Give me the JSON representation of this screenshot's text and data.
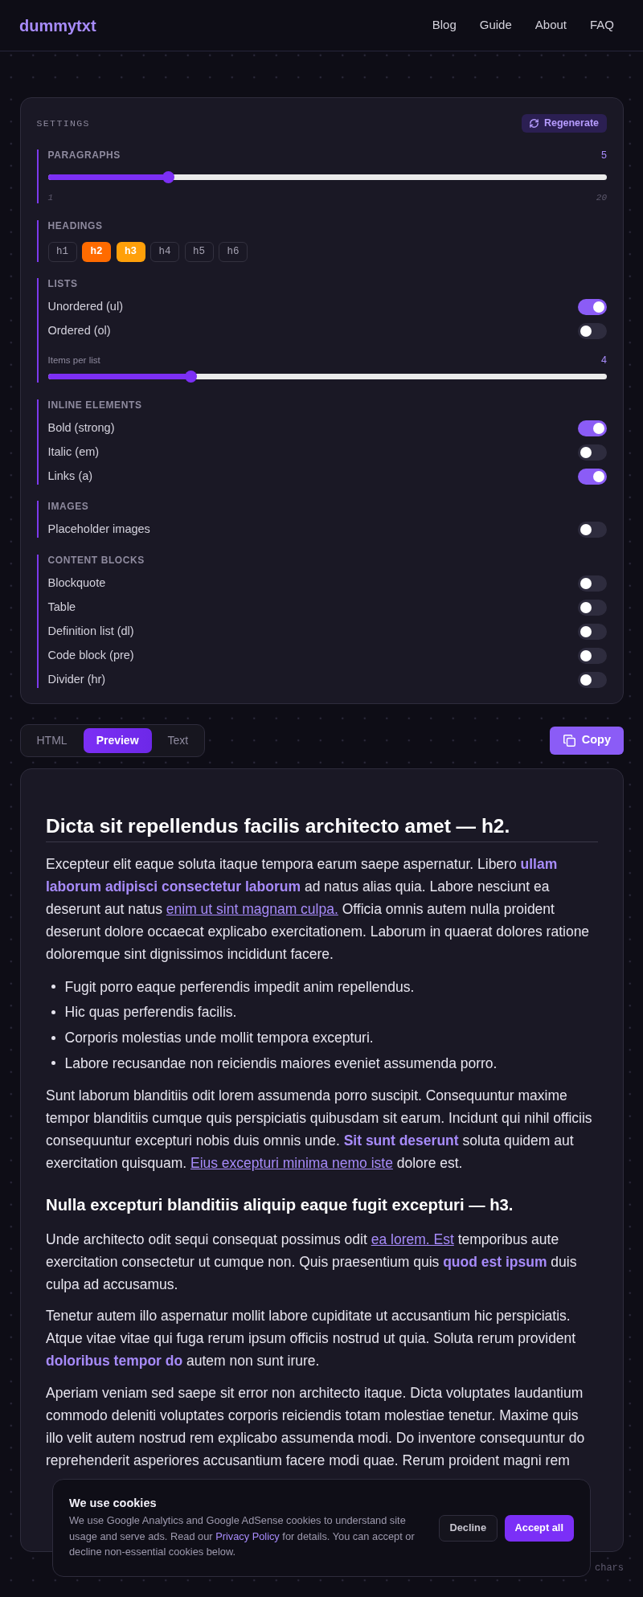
{
  "navbar": {
    "logo": "dummytxt",
    "links": [
      "Blog",
      "Guide",
      "About",
      "FAQ"
    ]
  },
  "settings": {
    "title": "SETTINGS",
    "regenerate_button": "Regenerate",
    "groups": [
      {
        "label": "PARAGRAPHS",
        "items": [
          {
            "kind": "slider",
            "value": "5",
            "level": 0.21,
            "min": "1",
            "max": "20"
          }
        ]
      },
      {
        "label": "HEADINGS",
        "items": [
          {
            "kind": "chips",
            "chips": [
              {
                "label": "h1",
                "selected": false
              },
              {
                "label": "h2",
                "selected": true,
                "color": "#ff6b00"
              },
              {
                "label": "h3",
                "selected": true,
                "color": "#ffa00a"
              },
              {
                "label": "h4",
                "selected": false
              },
              {
                "label": "h5",
                "selected": false
              },
              {
                "label": "h6",
                "selected": false
              }
            ]
          }
        ]
      },
      {
        "label": "LISTS",
        "items": [
          {
            "kind": "toggle",
            "label": "Unordered (ul)",
            "on": true
          },
          {
            "kind": "toggle",
            "label": "Ordered (ol)",
            "on": false
          },
          {
            "kind": "slider",
            "label": "Items per list",
            "value": "4",
            "level": 0.25
          }
        ]
      },
      {
        "label": "INLINE ELEMENTS",
        "items": [
          {
            "kind": "toggle",
            "label": "Bold (strong)",
            "on": true
          },
          {
            "kind": "toggle",
            "label": "Italic (em)",
            "on": false
          },
          {
            "kind": "toggle",
            "label": "Links (a)",
            "on": true
          }
        ]
      },
      {
        "label": "IMAGES",
        "items": [
          {
            "kind": "toggle",
            "label": "Placeholder images",
            "on": false
          }
        ]
      },
      {
        "label": "CONTENT BLOCKS",
        "items": [
          {
            "kind": "toggle",
            "label": "Blockquote",
            "on": false
          },
          {
            "kind": "toggle",
            "label": "Table",
            "on": false
          },
          {
            "kind": "toggle",
            "label": "Definition list (dl)",
            "on": false
          },
          {
            "kind": "toggle",
            "label": "Code block (pre)",
            "on": false
          },
          {
            "kind": "toggle",
            "label": "Divider (hr)",
            "on": false
          }
        ]
      }
    ]
  },
  "output_tabs": [
    {
      "label": "HTML",
      "selected": false
    },
    {
      "label": "Preview",
      "selected": true
    },
    {
      "label": "Text",
      "selected": false
    }
  ],
  "copy_button": "Copy",
  "preview": {
    "blocks": [
      {
        "kind": "h2",
        "text": "Dicta sit repellendus facilis architecto amet — h2."
      },
      {
        "kind": "paragraph",
        "segments": [
          {
            "kind": "text",
            "text": "Excepteur elit eaque soluta itaque tempora earum saepe aspernatur. Libero "
          },
          {
            "kind": "bold",
            "text": "ullam laborum adipisci consectetur laborum"
          },
          {
            "kind": "text",
            "text": " ad natus alias quia. Labore nesciunt ea deserunt aut natus "
          },
          {
            "kind": "link",
            "text": "enim ut sint magnam culpa."
          },
          {
            "kind": "text",
            "text": " Officia omnis autem nulla proident deserunt dolore occaecat explicabo exercitationem. Laborum in quaerat dolores ratione doloremque sint dignissimos incididunt facere."
          }
        ]
      },
      {
        "kind": "bullet_list",
        "items": [
          "Fugit porro eaque perferendis impedit anim repellendus.",
          "Hic quas perferendis facilis.",
          "Corporis molestias unde mollit tempora excepturi.",
          "Labore recusandae non reiciendis maiores eveniet assumenda porro."
        ]
      },
      {
        "kind": "paragraph",
        "segments": [
          {
            "kind": "text",
            "text": "Sunt laborum blanditiis odit lorem assumenda porro suscipit. Consequuntur maxime tempor blanditiis cumque quis perspiciatis quibusdam sit earum. Incidunt qui nihil officiis consequuntur excepturi nobis duis omnis unde. "
          },
          {
            "kind": "bold",
            "text": "Sit sunt deserunt"
          },
          {
            "kind": "text",
            "text": " soluta quidem aut exercitation quisquam. "
          },
          {
            "kind": "link",
            "text": "Eius excepturi minima nemo iste"
          },
          {
            "kind": "text",
            "text": " dolore est."
          }
        ]
      },
      {
        "kind": "h3",
        "text": "Nulla excepturi blanditiis aliquip eaque fugit excepturi — h3."
      },
      {
        "kind": "paragraph",
        "segments": [
          {
            "kind": "text",
            "text": "Unde architecto odit sequi consequat possimus odit "
          },
          {
            "kind": "link",
            "text": "ea lorem. Est"
          },
          {
            "kind": "text",
            "text": " temporibus aute exercitation consectetur ut cumque non. Quis praesentium quis "
          },
          {
            "kind": "bold",
            "text": "quod est ipsum"
          },
          {
            "kind": "text",
            "text": " duis culpa ad accusamus."
          }
        ]
      },
      {
        "kind": "paragraph",
        "segments": [
          {
            "kind": "text",
            "text": "Tenetur autem illo aspernatur mollit labore cupiditate ut accusantium hic perspiciatis. Atque vitae vitae qui fuga rerum ipsum officiis nostrud ut quia. Soluta rerum provident "
          },
          {
            "kind": "bold",
            "text": "doloribus tempor do"
          },
          {
            "kind": "text",
            "text": " autem non sunt irure."
          }
        ]
      },
      {
        "kind": "paragraph",
        "segments": [
          {
            "kind": "text",
            "text": "Aperiam veniam sed saepe sit error non architecto itaque. Dicta voluptates laudantium commodo deleniti voluptates corporis reiciendis totam molestiae tenetur. Maxime quis illo velit autem nostrud rem explicabo assumenda modi. Do inventore consequuntur do reprehenderit asperiores accusantium facere modi quae. Rerum proident magni rem"
          }
        ]
      }
    ]
  },
  "stats": "chars",
  "cookie_banner": {
    "title": "We use cookies",
    "segments": [
      {
        "kind": "text",
        "text": "We use Google Analytics and Google AdSense cookies to understand site usage and serve ads. Read our "
      },
      {
        "kind": "link",
        "text": "Privacy Policy"
      },
      {
        "kind": "text",
        "text": " for details. You can accept or decline non-essential cookies below."
      }
    ],
    "buttons": [
      {
        "kind": "secondary",
        "label": "Decline"
      },
      {
        "kind": "primary",
        "label": "Accept all"
      }
    ]
  }
}
